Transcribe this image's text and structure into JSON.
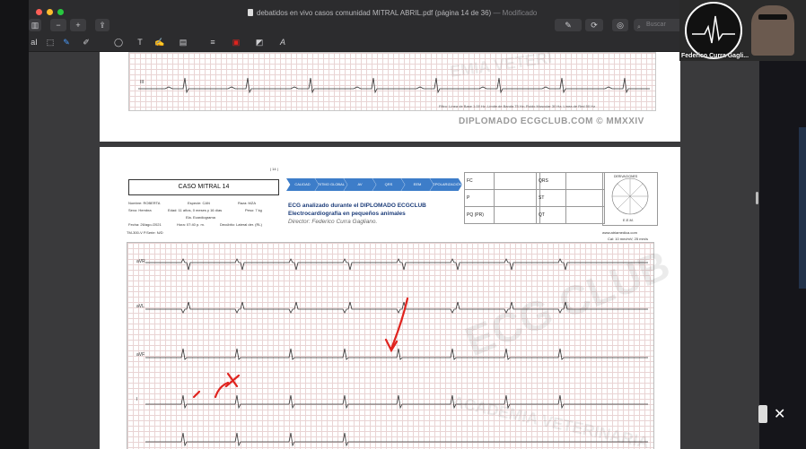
{
  "window": {
    "title_file": "debatidos en vivo casos comunidad MITRAL ABRIL.pdf (página 14 de 36)",
    "title_sep": "—",
    "title_status": "Modificado",
    "search_placeholder": "Buscar"
  },
  "colors": {
    "close": "#ff5f57",
    "minimize": "#febc2e",
    "zoom": "#28c840",
    "annotation": "#e0231e"
  },
  "toolbar": {
    "sidebar_icon": "sidebar-icon",
    "zoom_out": "−",
    "zoom_in": "+",
    "share": "⇪",
    "pen": "✎",
    "rotate": "⟳",
    "markup": "◎"
  },
  "markup_bar": {
    "text_select": "aI",
    "rect_select": "⬚",
    "sketch": "✎",
    "draw": "✐",
    "shapes": "◯",
    "text": "T",
    "sign": "✍",
    "note": "▤",
    "line_style": "≡",
    "border_color": "▣",
    "fill_color": "◩",
    "font": "A"
  },
  "page_top": {
    "lead_label": "III",
    "filter_note": "Filtro: Línea de Base 1.00 Hz; Límite de Banda 75 Hz; Ruido Muscular 30 Hz; Línea de Red 50 Hz",
    "diploma": "DIPLOMADO ECGCLUB.COM  ©  MMXXIV",
    "watermark": "EMIA VETERI"
  },
  "page_main": {
    "page_number": "| 14 |",
    "case_title": "CASO MITRAL 14",
    "fields": {
      "nombre": "Nombre: ROBERTA",
      "especie": "Especie: CAN",
      "raza": "Raza: MZA",
      "sexo": "Sexo: Hembra",
      "edad": "Edad: 11 años, 0 meses y 16 días",
      "peso": "Peso: 7 kg",
      "fecha": "Fecha: 26/ago./2021",
      "hora": "Hora: 07:40 p. m.",
      "decubito": "Decúbito: Lateral der. (RL)",
      "tipo": "Ela. Ecardiograma"
    },
    "steps": [
      "CALIDAD DIAGNÓSTICA",
      "RITMO GLOBAL",
      "AV",
      "QRS",
      "EEM",
      "REPOLARIZACIÓN"
    ],
    "analyzed": "ECG analizado durante el DIPLOMADO ECGCLUB",
    "subtitle": "Electrocardiografía en pequeños animales",
    "director": "Director: Federico Curra Gagliano.",
    "params_left": [
      "FC",
      "P",
      "PQ (PR)"
    ],
    "params_right": [
      "QRS",
      "ST",
      "QT"
    ],
    "axis_label": "DERIVACIONES",
    "eem_label": "E.E.M.",
    "device": "TM-300-V  P.Serie: N/D",
    "website": "www.atriamedica.com",
    "calibration": "Cal: 10 mm/mV; 25 mm/s",
    "leads": [
      "aVR",
      "aVL",
      "aVF",
      "I"
    ],
    "watermark_text": "ECG CLUB",
    "watermark_bottom": "ACADEMIA VETERINARIA"
  },
  "webcam": {
    "name": "Federico Curra Gagli..."
  },
  "overlay": {
    "close": "✕"
  }
}
